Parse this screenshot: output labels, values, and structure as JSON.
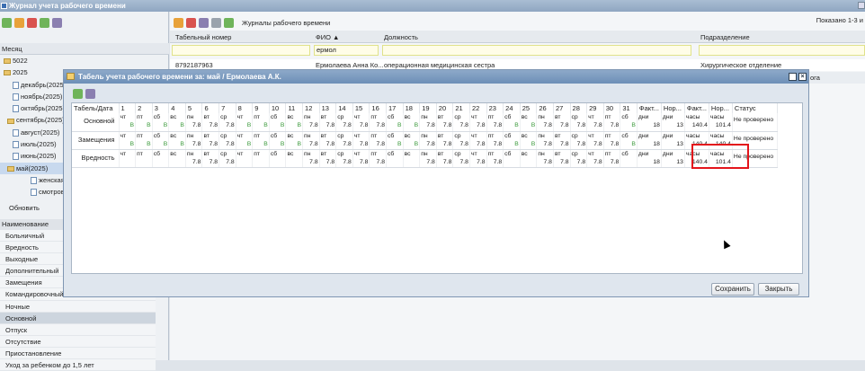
{
  "app": {
    "title": "Журнал учета рабочего времени"
  },
  "left": {
    "month_header": "Месяц",
    "tree": [
      "5022",
      "2025",
      "декабрь(2025)",
      "ноябрь(2025)",
      "октябрь(2025)",
      "сентябрь(2025)",
      "август(2025)",
      "июль(2025)",
      "июнь(2025)",
      "май(2025)",
      "женская к",
      "смотрово"
    ],
    "refresh": "Обновить",
    "name_header": "Наименование",
    "names": [
      "Больничный",
      "Вредность",
      "Выходные",
      "Дополнительный",
      "Замещения",
      "Командировочный",
      "Ночные",
      "Основной",
      "Отпуск",
      "Отсутствие",
      "Приостановление",
      "Уход за ребенком до 1,5 лет"
    ]
  },
  "main": {
    "toolbar_label": "Журналы рабочего времени",
    "shown": "Показано 1-3 и",
    "cols": {
      "tab": "Табельный номер",
      "fio": "ФИО ▲",
      "pos": "Должность",
      "dept": "Подразделение"
    },
    "filter_fio": "ермол",
    "row": {
      "tab": "8792187963",
      "fio": "Ермолаева Анна Ко...",
      "pos": "операционная медицинская сестра",
      "dept": "Хирургическое отделение"
    },
    "row2_dept_frag": "ога"
  },
  "modal": {
    "title": "Табель учета рабочего времени за: май / Ермолаева А.К.",
    "header": {
      "first": "Табель/Дата",
      "days": [
        "1",
        "2",
        "3",
        "4",
        "5",
        "6",
        "7",
        "8",
        "9",
        "10",
        "11",
        "12",
        "13",
        "14",
        "15",
        "16",
        "17",
        "18",
        "19",
        "20",
        "21",
        "22",
        "23",
        "24",
        "25",
        "26",
        "27",
        "28",
        "29",
        "30",
        "31"
      ],
      "fact": "Факт...",
      "norm_d": "Нор...",
      "fact_h": "Факт...",
      "norm_h": "Нор...",
      "status": "Статус"
    },
    "weekdays": [
      "чт",
      "пт",
      "сб",
      "вс",
      "пн",
      "вт",
      "ср",
      "чт",
      "пт",
      "сб",
      "вс",
      "пн",
      "вт",
      "ср",
      "чт",
      "пт",
      "сб",
      "вс",
      "пн",
      "вт",
      "ср",
      "чт",
      "пт",
      "сб",
      "вс",
      "пн",
      "вт",
      "ср",
      "чт",
      "пт",
      "сб"
    ],
    "rows": [
      {
        "label": "Основной",
        "vals": [
          "В",
          "В",
          "В",
          "В",
          "7.8",
          "7.8",
          "7.8",
          "В",
          "В",
          "В",
          "В",
          "7.8",
          "7.8",
          "7.8",
          "7.8",
          "7.8",
          "В",
          "В",
          "7.8",
          "7.8",
          "7.8",
          "7.8",
          "7.8",
          "В",
          "В",
          "7.8",
          "7.8",
          "7.8",
          "7.8",
          "7.8",
          "В"
        ],
        "fd_u": "дни",
        "fd": "18",
        "nd_u": "дни",
        "nd": "13",
        "fh_u": "часы",
        "fh": "140.4",
        "nh_u": "часы",
        "nh": "101.4",
        "status": "Не проверено"
      },
      {
        "label": "Замещения",
        "vals": [
          "В",
          "В",
          "В",
          "В",
          "7.8",
          "7.8",
          "7.8",
          "В",
          "В",
          "В",
          "В",
          "7.8",
          "7.8",
          "7.8",
          "7.8",
          "7.8",
          "В",
          "В",
          "7.8",
          "7.8",
          "7.8",
          "7.8",
          "7.8",
          "В",
          "В",
          "7.8",
          "7.8",
          "7.8",
          "7.8",
          "7.8",
          "В"
        ],
        "fd_u": "дни",
        "fd": "18",
        "nd_u": "дни",
        "nd": "13",
        "fh_u": "часы",
        "fh": "140.4",
        "nh_u": "часы",
        "nh": "140.4",
        "status": "Не проверено"
      },
      {
        "label": "Вредность",
        "vals": [
          "",
          "",
          "",
          "",
          "7.8",
          "7.8",
          "7.8",
          "",
          "",
          "",
          "",
          "7.8",
          "7.8",
          "7.8",
          "7.8",
          "7.8",
          "",
          "",
          "7.8",
          "7.8",
          "7.8",
          "7.8",
          "7.8",
          "",
          "",
          "7.8",
          "7.8",
          "7.8",
          "7.8",
          "7.8",
          ""
        ],
        "fd_u": "дни",
        "fd": "18",
        "nd_u": "дни",
        "nd": "13",
        "fh_u": "часы",
        "fh": "140.4",
        "nh_u": "часы",
        "nh": "101.4",
        "status": "Не проверено"
      }
    ],
    "save": "Сохранить",
    "close": "Закрыть"
  }
}
